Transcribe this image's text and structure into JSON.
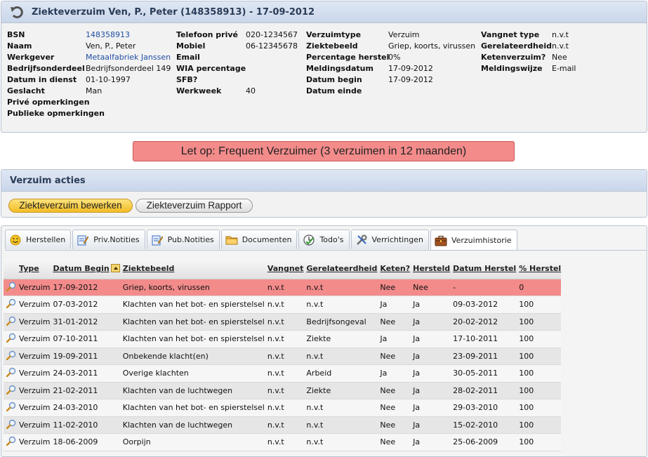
{
  "header": {
    "title": "Ziekteverzuim Ven, P., Peter (148358913) - 17-09-2012"
  },
  "employee": {
    "col1": [
      {
        "label": "BSN",
        "value": "148358913"
      },
      {
        "label": "Naam",
        "value": "Ven, P., Peter"
      },
      {
        "label": "Werkgever",
        "value": "Metaalfabriek Janssen"
      },
      {
        "label": "Bedrijfsonderdeel",
        "value": "Bedrijfsonderdeel 149"
      },
      {
        "label": "Datum in dienst",
        "value": "01-10-1997"
      },
      {
        "label": "Geslacht",
        "value": "Man"
      },
      {
        "label": "Privé opmerkingen",
        "value": ""
      },
      {
        "label": "Publieke opmerkingen",
        "value": ""
      }
    ],
    "col2": [
      {
        "label": "Telefoon privé",
        "value": "020-1234567"
      },
      {
        "label": "Mobiel",
        "value": "06-12345678"
      },
      {
        "label": "Email",
        "value": ""
      },
      {
        "label": "WIA percentage",
        "value": ""
      },
      {
        "label": "SFB?",
        "value": ""
      },
      {
        "label": "Werkweek",
        "value": "40"
      }
    ],
    "col3": [
      {
        "label": "Verzuimtype",
        "value": "Verzuim"
      },
      {
        "label": "Ziektebeeld",
        "value": "Griep, koorts, virussen"
      },
      {
        "label": "Percentage herstel",
        "value": "0%"
      },
      {
        "label": "Meldingsdatum",
        "value": "17-09-2012"
      },
      {
        "label": "Datum begin",
        "value": "17-09-2012"
      },
      {
        "label": "Datum einde",
        "value": ""
      }
    ],
    "col4": [
      {
        "label": "Vangnet type",
        "value": "n.v.t"
      },
      {
        "label": "Gerelateerdheid",
        "value": "n.v.t"
      },
      {
        "label": "Ketenverzuim?",
        "value": "Nee"
      },
      {
        "label": "Meldingswijze",
        "value": "E-mail"
      }
    ]
  },
  "alert": {
    "text": "Let op: Frequent Verzuimer (3 verzuimen in 12 maanden)",
    "color": "#f38b8b"
  },
  "actions": {
    "title": "Verzuim acties",
    "edit_label": "Ziekteverzuim bewerken",
    "report_label": "Ziekteverzuim Rapport"
  },
  "tabs": [
    {
      "label": "Herstellen",
      "icon": "smiley-icon"
    },
    {
      "label": "Priv.Notities",
      "icon": "note-pencil-icon"
    },
    {
      "label": "Pub.Notities",
      "icon": "note-pencil-icon"
    },
    {
      "label": "Documenten",
      "icon": "folder-icon"
    },
    {
      "label": "Todo's",
      "icon": "clock-check-icon"
    },
    {
      "label": "Verrichtingen",
      "icon": "tools-icon"
    },
    {
      "label": "Verzuimhistorie",
      "icon": "briefcase-icon",
      "active": true
    }
  ],
  "table": {
    "headers": [
      "Type",
      "Datum Begin",
      "Ziektebeeld",
      "Vangnet",
      "Gerelateerdheid",
      "Keten?",
      "Hersteld",
      "Datum Herstel",
      "% Herstel"
    ],
    "rows": [
      [
        "Verzuim",
        "17-09-2012",
        "Griep, koorts, virussen",
        "n.v.t",
        "n.v.t",
        "Nee",
        "Nee",
        "-",
        "0"
      ],
      [
        "Verzuim",
        "07-03-2012",
        "Klachten van het bot- en spierstelsel",
        "n.v.t",
        "n.v.t",
        "Ja",
        "Ja",
        "09-03-2012",
        "100"
      ],
      [
        "Verzuim",
        "31-01-2012",
        "Klachten van het bot- en spierstelsel",
        "n.v.t",
        "Bedrijfsongeval",
        "Nee",
        "Ja",
        "20-02-2012",
        "100"
      ],
      [
        "Verzuim",
        "07-10-2011",
        "Klachten van het bot- en spierstelsel",
        "n.v.t",
        "Ziekte",
        "Ja",
        "Ja",
        "17-10-2011",
        "100"
      ],
      [
        "Verzuim",
        "19-09-2011",
        "Onbekende klacht(en)",
        "n.v.t",
        "n.v.t",
        "Nee",
        "Ja",
        "23-09-2011",
        "100"
      ],
      [
        "Verzuim",
        "24-03-2011",
        "Overige klachten",
        "n.v.t",
        "Arbeid",
        "Ja",
        "Ja",
        "30-05-2011",
        "100"
      ],
      [
        "Verzuim",
        "21-02-2011",
        "Klachten van de luchtwegen",
        "n.v.t",
        "Ziekte",
        "Nee",
        "Ja",
        "28-02-2011",
        "100"
      ],
      [
        "Verzuim",
        "24-03-2010",
        "Klachten van het bot- en spierstelsel",
        "n.v.t",
        "n.v.t",
        "Nee",
        "Ja",
        "29-03-2010",
        "100"
      ],
      [
        "Verzuim",
        "11-02-2010",
        "Klachten van de luchtwegen",
        "n.v.t",
        "n.v.t",
        "Nee",
        "Ja",
        "15-02-2010",
        "100"
      ],
      [
        "Verzuim",
        "18-06-2009",
        "Oorpijn",
        "n.v.t",
        "n.v.t",
        "Nee",
        "Ja",
        "25-06-2009",
        "100"
      ]
    ]
  }
}
